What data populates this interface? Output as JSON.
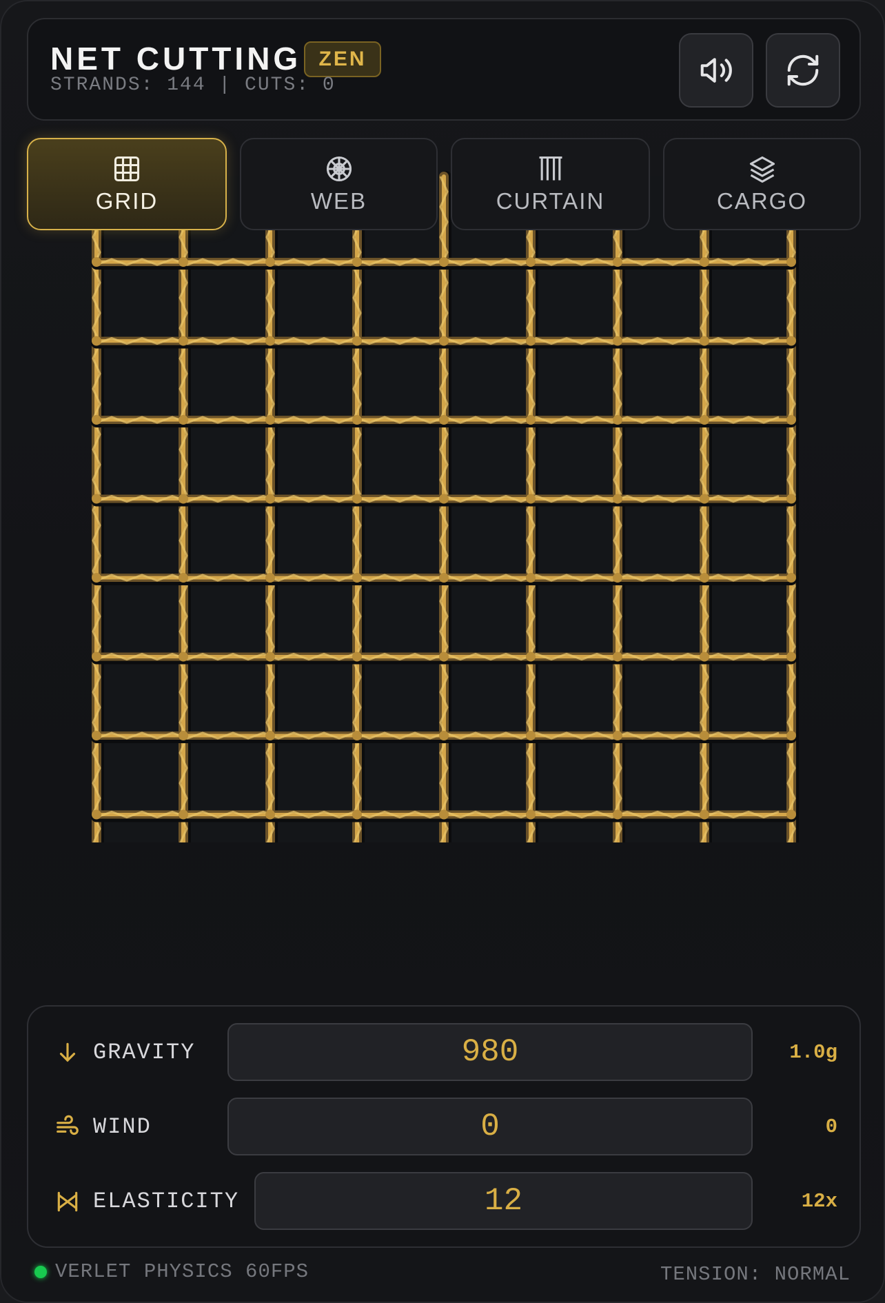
{
  "header": {
    "title": "NET CUTTING",
    "badge": "ZEN",
    "stats": "STRANDS: 144 | CUTS: 0",
    "sound_icon": "speaker-volume-icon",
    "reset_icon": "refresh-icon"
  },
  "modes": [
    {
      "label": "GRID",
      "icon": "grid-icon",
      "active": true
    },
    {
      "label": "WEB",
      "icon": "web-icon",
      "active": false
    },
    {
      "label": "CURTAIN",
      "icon": "curtain-icon",
      "active": false
    },
    {
      "label": "CARGO",
      "icon": "layers-icon",
      "active": false
    }
  ],
  "net": {
    "columns": 9,
    "rows": 8,
    "strand_color": "#d4a64a",
    "shadow_color": "#6b5228"
  },
  "controls": {
    "gravity": {
      "label": "GRAVITY",
      "value": "980",
      "readout": "1.0g",
      "icon": "arrow-down-icon"
    },
    "wind": {
      "label": "WIND",
      "value": "0",
      "readout": "0",
      "icon": "wind-icon"
    },
    "elasticity": {
      "label": "ELASTICITY",
      "value": "12",
      "readout": "12x",
      "icon": "elasticity-icon"
    }
  },
  "footer": {
    "status": "VERLET PHYSICS 60FPS",
    "tension": "TENSION: NORMAL"
  },
  "colors": {
    "accent": "#d9af45",
    "status_dot": "#18c94f"
  }
}
